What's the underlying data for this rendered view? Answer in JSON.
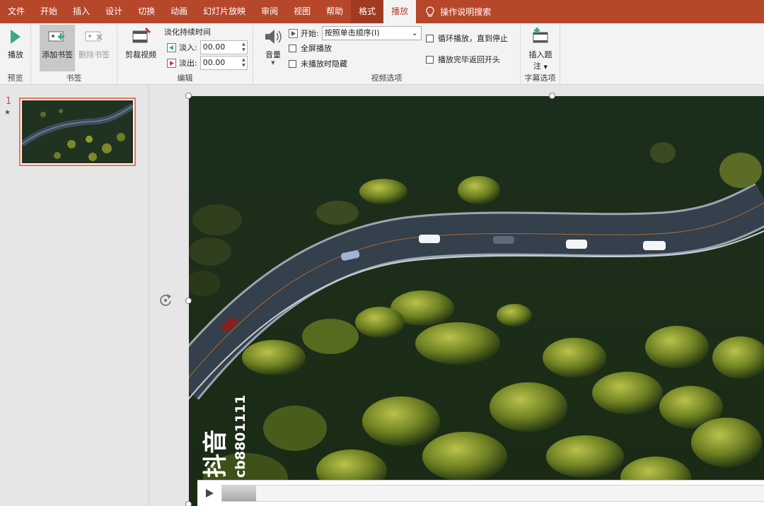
{
  "menubar": {
    "tabs": [
      "文件",
      "开始",
      "插入",
      "设计",
      "切换",
      "动画",
      "幻灯片放映",
      "审阅",
      "视图",
      "帮助"
    ],
    "ctx_tabs": [
      "格式",
      "播放"
    ],
    "active_tab": "播放",
    "tell_me": "操作说明搜索"
  },
  "ribbon": {
    "preview": {
      "play_label": "播放",
      "group": "预览"
    },
    "bookmarks": {
      "add_label": "添加书签",
      "remove_label": "删除书签",
      "group": "书签"
    },
    "editing": {
      "trim_label": "剪裁视频",
      "fade_title": "淡化持续时间",
      "fade_in_label": "淡入:",
      "fade_in_value": "00.00",
      "fade_out_label": "淡出:",
      "fade_out_value": "00.00",
      "group": "编辑"
    },
    "video_options": {
      "volume_label": "音量",
      "start_label": "开始:",
      "start_value": "按照单击顺序(I)",
      "fullscreen_label": "全屏播放",
      "hide_label": "未播放时隐藏",
      "loop_label": "循环播放，直到停止",
      "rewind_label": "播放完毕返回开头",
      "group": "视频选项"
    },
    "captions": {
      "insert_label_1": "插入题",
      "insert_label_2": "注",
      "group": "字幕选项"
    }
  },
  "thumbnails": {
    "slide_number": "1",
    "star": "★"
  },
  "video": {
    "watermark_app": "抖音",
    "watermark_id": "cb8801111",
    "progress_fraction": 0.06
  },
  "colors": {
    "accent": "#b7472a",
    "thumb_border": "#e97550"
  }
}
